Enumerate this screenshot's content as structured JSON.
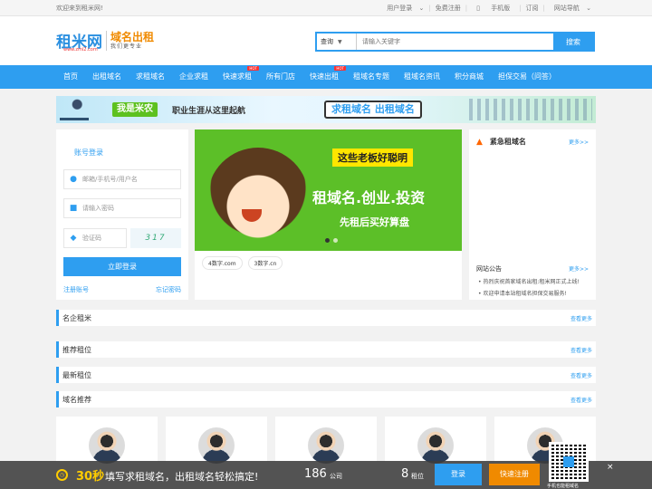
{
  "topbar": {
    "welcome": "欢迎来到租米网!",
    "links": [
      "用户登录",
      "免费注册",
      "手机版",
      "订阅",
      "网站导航"
    ]
  },
  "logo": {
    "main": "租米网",
    "url": "www.zmi2.com",
    "slogan": "域名出租",
    "tagline": "我们更专业"
  },
  "search": {
    "select": "查询",
    "placeholder": "请输入关键字",
    "button": "搜索"
  },
  "nav": [
    {
      "label": "首页",
      "hot": ""
    },
    {
      "label": "出租域名",
      "hot": ""
    },
    {
      "label": "求租域名",
      "hot": ""
    },
    {
      "label": "企业求租",
      "hot": ""
    },
    {
      "label": "快速求租",
      "hot": "HOT"
    },
    {
      "label": "所有门店",
      "hot": ""
    },
    {
      "label": "快速出租",
      "hot": "HOT"
    },
    {
      "label": "租域名专题",
      "hot": ""
    },
    {
      "label": "租域名资讯",
      "hot": ""
    },
    {
      "label": "积分商城",
      "hot": ""
    },
    {
      "label": "担保交易（问答）",
      "hot": ""
    }
  ],
  "banner": {
    "badge": "我是米农",
    "text": "职业生涯从这里起航",
    "slogan": "求租域名 出租域名"
  },
  "login": {
    "title": "账号登录",
    "user_placeholder": "邮箱/手机号/用户名",
    "pass_placeholder": "请输入密码",
    "code_placeholder": "验证码",
    "captcha": "317",
    "submit": "立即登录",
    "register": "注册账号",
    "forgot": "忘记密码"
  },
  "slider": {
    "line1": "这些老板好聪明",
    "line2": "租域名.创业.投资",
    "line3": "先租后买好算盘",
    "tags": [
      "4数字.com",
      "3数字.cn"
    ]
  },
  "urgent": {
    "title": "紧急租域名",
    "more": "更多>>",
    "notice_title": "网站公告",
    "notice_more": "更多>>",
    "notices": [
      "热烈庆祝首家域名出租:租米网正式上线!",
      "欢迎申请本站租域名担保交易服务!"
    ]
  },
  "sections": [
    {
      "title": "名企租米",
      "more": "查看更多"
    },
    {
      "title": "推荐租位",
      "more": "查看更多"
    },
    {
      "title": "最新租位",
      "more": "查看更多"
    },
    {
      "title": "域名推荐",
      "more": "查看更多"
    }
  ],
  "footer": {
    "seconds": "30秒",
    "text": "填写求租域名，出租域名轻松搞定!",
    "count1": "186",
    "count1_suffix": "公司",
    "count2": "8",
    "count2_suffix": "租位",
    "login": "登录",
    "register": "快速注册",
    "qr_caption": "手机也能租域名",
    "close": "×"
  },
  "colors": {
    "primary": "#2e9ef0",
    "accent": "#f08a00",
    "green": "#5cbf28"
  }
}
